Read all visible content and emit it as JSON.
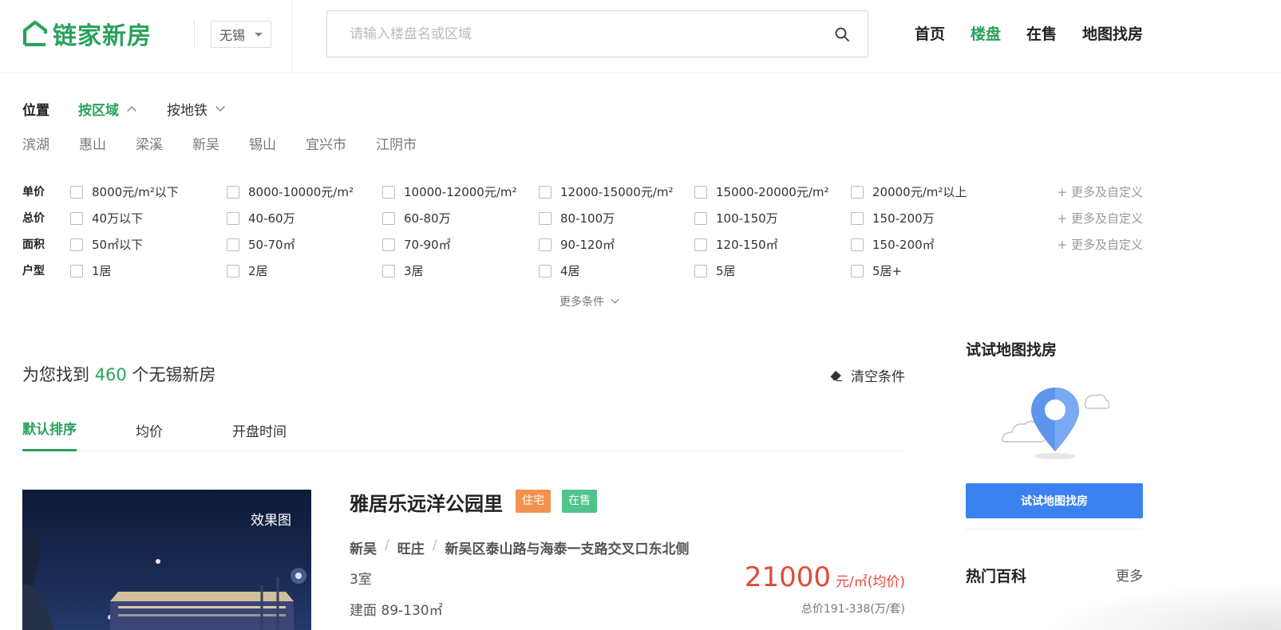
{
  "header": {
    "logo_text": "链家新房",
    "city": "无锡",
    "search_placeholder": "请输入楼盘名或区域",
    "nav": [
      {
        "label": "首页",
        "active": false
      },
      {
        "label": "楼盘",
        "active": true
      },
      {
        "label": "在售",
        "active": false
      },
      {
        "label": "地图找房",
        "active": false
      }
    ]
  },
  "location": {
    "label": "位置",
    "tabs": [
      "按区域",
      "按地铁"
    ],
    "districts": [
      "滨湖",
      "惠山",
      "梁溪",
      "新吴",
      "锡山",
      "宜兴市",
      "江阴市"
    ]
  },
  "filters": {
    "more_custom": "+ 更多及自定义",
    "more_conditions": "更多条件",
    "rows": [
      {
        "label": "单价",
        "options": [
          "8000元/m²以下",
          "8000-10000元/m²",
          "10000-12000元/m²",
          "12000-15000元/m²",
          "15000-20000元/m²",
          "20000元/m²以上"
        ]
      },
      {
        "label": "总价",
        "options": [
          "40万以下",
          "40-60万",
          "60-80万",
          "80-100万",
          "100-150万",
          "150-200万"
        ]
      },
      {
        "label": "面积",
        "options": [
          "50㎡以下",
          "50-70㎡",
          "70-90㎡",
          "90-120㎡",
          "120-150㎡",
          "150-200㎡"
        ]
      },
      {
        "label": "户型",
        "options": [
          "1居",
          "2居",
          "3居",
          "4居",
          "5居",
          "5居+"
        ]
      }
    ]
  },
  "results": {
    "prefix": "为您找到",
    "count": "460",
    "suffix": "个无锡新房",
    "clear": "清空条件",
    "sort_tabs": [
      "默认排序",
      "均价",
      "开盘时间"
    ]
  },
  "listing": {
    "image_badge": "效果图",
    "name": "雅居乐远洋公园里",
    "tag_type": "住宅",
    "tag_status": "在售",
    "district": "新吴",
    "area": "旺庄",
    "address": "新吴区泰山路与海泰一支路交叉口东北侧",
    "rooms": "3室",
    "floor_area": "建面 89-130㎡",
    "price": "21000",
    "price_unit": "元/㎡(均价)",
    "total_price": "总价191-338(万/套)"
  },
  "sidebar": {
    "map_title": "试试地图找房",
    "map_button": "试试地图找房",
    "hot_title": "热门百科",
    "hot_more": "更多"
  },
  "colors": {
    "brand_green": "#2aa15c",
    "price_red": "#e34a3a",
    "map_blue": "#3b82f0",
    "tag_orange": "#f3924c",
    "tag_green": "#50c48a"
  }
}
